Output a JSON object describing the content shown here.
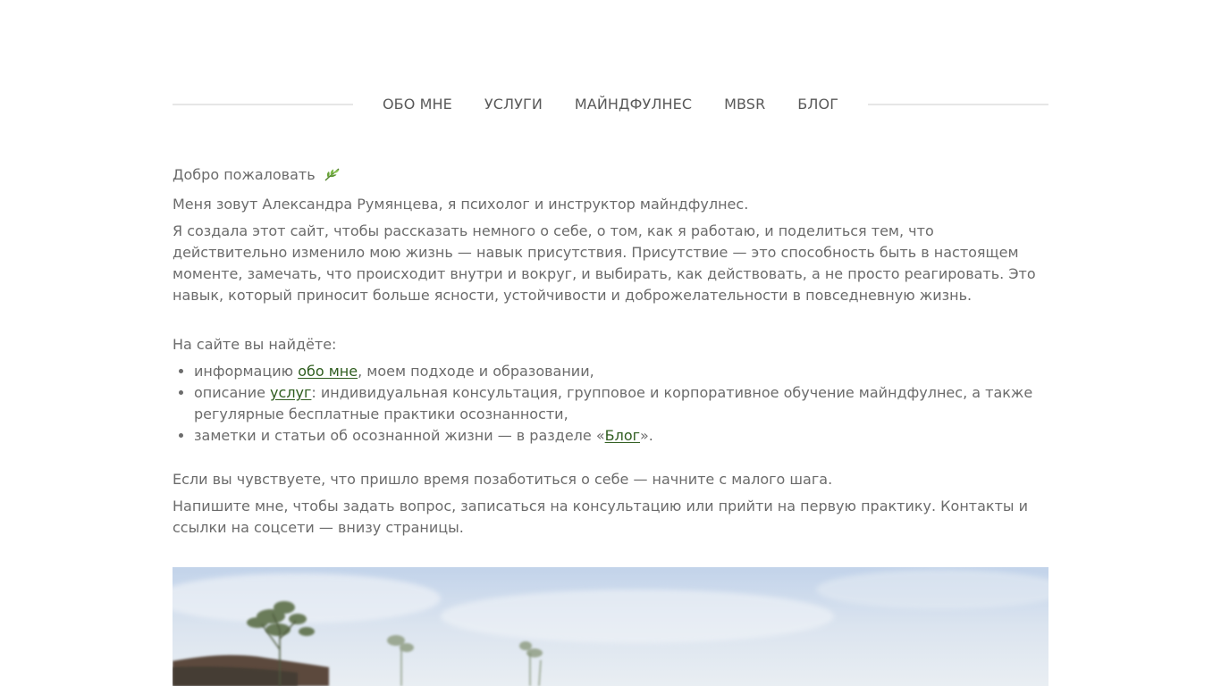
{
  "nav": {
    "items": [
      "ОБО МНЕ",
      "УСЛУГИ",
      "МАЙНДФУЛНЕС",
      "MBSR",
      "БЛОГ"
    ]
  },
  "content": {
    "welcome": "Добро пожаловать",
    "welcome_icon": "leaf-icon",
    "intro": "Меня зовут Александра Румянцева, я психолог и инструктор майндфулнес.",
    "paragraph": "Я создала этот сайт, чтобы рассказать немного о себе, о том, как я работаю, и поделиться тем, что действительно изменило мою жизнь — навык присутствия. Присутствие — это способность быть в настоящем моменте, замечать, что происходит внутри и вокруг, и выбирать, как действовать, а не просто реагировать. Это навык, который приносит больше ясности, устойчивости и доброжелательности в повседневную жизнь.",
    "list_heading": "На сайте вы найдёте:",
    "list": [
      {
        "before": "информацию ",
        "link": "обо мне",
        "after": ", моем подходе и образовании,"
      },
      {
        "before": "описание ",
        "link": "услуг",
        "after": ": индивидуальная консультация, групповое и корпоративное обучение майндфулнес, а также регулярные бесплатные практики осознанности,"
      },
      {
        "before": "заметки и статьи об осознанной жизни — в разделе «",
        "link": "Блог",
        "after": "»."
      }
    ],
    "closing_1": "Если вы чувствуете, что пришло время позаботиться о себе — начните с малого шага.",
    "closing_2": "Напишите мне, чтобы задать вопрос, записаться на консультацию или прийти на первую практику. Контакты и ссылки на соцсети — внизу страницы."
  },
  "colors": {
    "link": "#2f5d1f",
    "text": "#6b6b6b",
    "nav_line": "#e6e6e6"
  }
}
